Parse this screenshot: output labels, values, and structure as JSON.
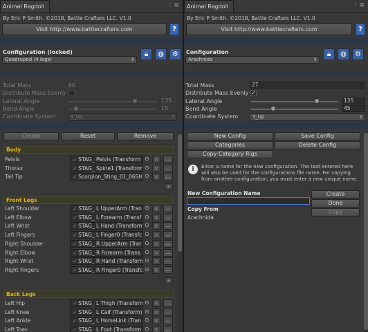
{
  "left": {
    "tab_title": "Animal Ragdoll",
    "byline": "By Eric P Smith.  ©2018, Battle Crafters LLC. V1.0",
    "visit_label": "Visit http://www.battlecrafters.com",
    "help_label": "?",
    "config_header": "Configuration (locked)",
    "config_value": "Quadruped (4 legs)",
    "props": {
      "total_mass": {
        "label": "Total Mass",
        "value": "60"
      },
      "distribute": {
        "label": "Distribute Mass Evenly"
      },
      "lateral": {
        "label": "Lateral Angle",
        "value": "135"
      },
      "bend": {
        "label": "Bend Angle",
        "value": "15"
      },
      "coord": {
        "label": "Coordinate System",
        "value": "Y_Up"
      }
    },
    "buttons": {
      "create": "Create",
      "reset": "Reset",
      "remove": "Remove"
    },
    "sections": {
      "body": "Body",
      "front": "Front Legs",
      "back": "Back Legs"
    },
    "body_rows": [
      {
        "label": "Pelvis",
        "value": "STAG_ Pelvis (Transform"
      },
      {
        "label": "Thorax",
        "value": "STAG_ Spine1 (Transform"
      },
      {
        "label": "Tail Tip",
        "value": "Scorpion_Sting_01_06SH"
      }
    ],
    "front_rows": [
      {
        "label": "Left Shoulder",
        "value": "STAG_ L UpperArm (Tran"
      },
      {
        "label": "Left Elbow",
        "value": "STAG_ L Forearm (Transf"
      },
      {
        "label": "Left Wrist",
        "value": "STAG_ L Hand (Transform"
      },
      {
        "label": "Left Fingers",
        "value": "STAG_ L Finger0 (Transfc"
      },
      {
        "label": "Right Shoulder",
        "value": "STAG_ R UpperArm (Trar"
      },
      {
        "label": "Right Elbow",
        "value": "STAG_ R Forearm (Trans"
      },
      {
        "label": "Right Wrist",
        "value": "STAG_ R Hand (Transform"
      },
      {
        "label": "Right Fingers",
        "value": "STAG_ R Finger0 (Transfc"
      }
    ],
    "back_rows": [
      {
        "label": "Left Hip",
        "value": "STAG_ L Thigh (Transform"
      },
      {
        "label": "Left Knee",
        "value": "STAG_ L Calf (Transform)"
      },
      {
        "label": "Left Ankle",
        "value": "STAG_ L HorseLink (Tran"
      },
      {
        "label": "Left Toes",
        "value": "STAG_ L Foot (Transform"
      }
    ],
    "row_circle": "⊙",
    "row_x": "×",
    "row_dots": "…",
    "row_plus": "+"
  },
  "right": {
    "tab_title": "Animal Ragdoll",
    "byline": "By Eric P Smith.  ©2018, Battle Crafters LLC. V1.0",
    "visit_label": "Visit http://www.battlecrafters.com",
    "help_label": "?",
    "config_header": "Configuration",
    "config_value": "Arachnida",
    "props": {
      "total_mass": {
        "label": "Total Mass",
        "value": "27"
      },
      "distribute": {
        "label": "Distribute Mass Evenly",
        "checked": "✓"
      },
      "lateral": {
        "label": "Lateral Angle",
        "value": "135"
      },
      "bend": {
        "label": "Bend Angle",
        "value": "45"
      },
      "coord": {
        "label": "Coordinate System",
        "value": "Y_Up"
      }
    },
    "buttons": {
      "new_config": "New Config",
      "save_config": "Save Config",
      "categories": "Categories",
      "delete_config": "Delete Config",
      "copy_rigs": "Copy Category Rigs"
    },
    "info_text": "Enter a name for the new configuration.  The text entered here will also be used for the configurations file name.  For copying from another configuration, you must enter a new unique name.",
    "info_icon": "i",
    "new_name_label": "New Configuration Name",
    "new_name_value": "",
    "create": "Create",
    "done": "Done",
    "copy": "Copy",
    "copy_from_label": "Copy From",
    "copy_from_value": "Arachnida"
  },
  "icons": {
    "lock": "lock-icon",
    "globe": "globe-icon",
    "gear": "gear-icon"
  },
  "colors": {
    "accent_blue": "#3a68b0",
    "section_text": "#e0b020",
    "panel_bg": "#383838"
  }
}
